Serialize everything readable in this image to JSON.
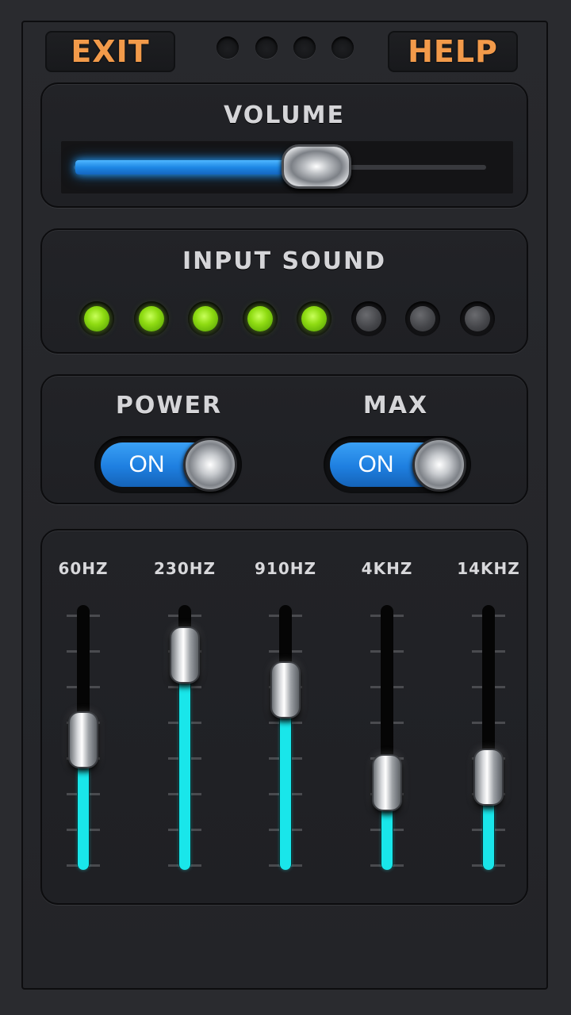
{
  "header": {
    "exit_label": "EXIT",
    "help_label": "HELP",
    "dots_count": 4
  },
  "volume": {
    "title": "VOLUME",
    "level": 0.58,
    "accent": "#2196f3"
  },
  "input_sound": {
    "title": "INPUT SOUND",
    "leds": [
      true,
      true,
      true,
      true,
      true,
      false,
      false,
      false
    ],
    "on_color": "#8fdc12"
  },
  "switches": [
    {
      "title": "POWER",
      "state_label": "ON",
      "on": true
    },
    {
      "title": "MAX",
      "state_label": "ON",
      "on": true
    }
  ],
  "equalizer": {
    "accent": "#19e6ea",
    "bands": [
      {
        "label": "60HZ",
        "level": 0.49
      },
      {
        "label": "230HZ",
        "level": 0.81
      },
      {
        "label": "910HZ",
        "level": 0.68
      },
      {
        "label": "4KHZ",
        "level": 0.33
      },
      {
        "label": "14KHZ",
        "level": 0.35
      }
    ]
  }
}
